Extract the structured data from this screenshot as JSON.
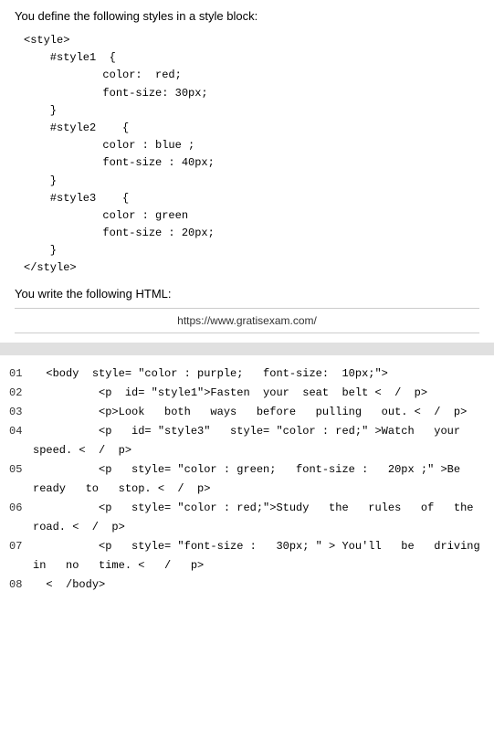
{
  "intro": {
    "text": "You define the following styles in a style block:"
  },
  "styleBlock": {
    "lines": [
      "<style>",
      "    #style1  {",
      "            color:  red;",
      "            font-size: 30px;",
      "    }",
      "    #style2    {",
      "            color : blue ;",
      "            font-size : 40px;",
      "    }",
      "    #style3    {",
      "            color : green",
      "            font-size : 20px;",
      "    }",
      "</style>"
    ]
  },
  "htmlIntro": {
    "text": "You write the following HTML:"
  },
  "url": {
    "text": "https://www.gratisexam.com/"
  },
  "numberedLines": [
    {
      "num": "01",
      "content": "  <body  style= \"color : purple;   font-size:  10px;\">"
    },
    {
      "num": "02",
      "content": "          <p  id= \"style1\">Fasten  your  seat  belt <  /  p>"
    },
    {
      "num": "03",
      "content": "          <p>Look   both   ways   before   pulling   out. <  /  p>"
    },
    {
      "num": "04",
      "content": "          <p   id= \"style3\"   style= \"color : red;\" >Watch   your speed. <  /  p>"
    },
    {
      "num": "05",
      "content": "          <p   style= \"color : green;   font-size :   20px ;\" >Be ready   to   stop. <  /  p>"
    },
    {
      "num": "06",
      "content": "          <p   style= \"color : red;\">Study   the   rules   of   the road. <  /  p>"
    },
    {
      "num": "07",
      "content": "          <p   style= \"font-size :   30px; \" > You'll   be   driving in   no   time. <   /   p>"
    },
    {
      "num": "08",
      "content": "  <  /body>"
    }
  ]
}
